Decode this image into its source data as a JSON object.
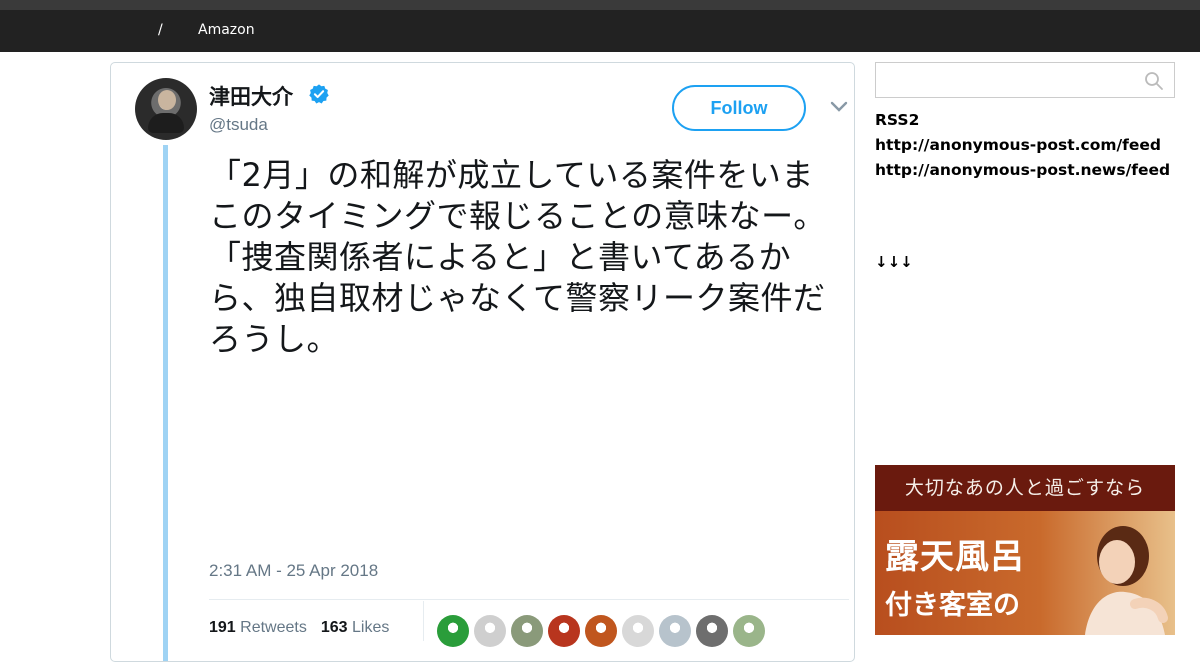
{
  "nav": {
    "separator": "/",
    "link": "Amazon"
  },
  "tweet": {
    "display_name": "津田大介",
    "handle": "@tsuda",
    "follow_label": "Follow",
    "text": "「2月」の和解が成立している案件をいまこのタイミングで報じることの意味なー。「捜査関係者によると」と書いてあるから、独自取材じゃなくて警察リーク案件だろうし。",
    "timestamp": "2:31 AM - 25 Apr 2018",
    "retweets_count": "191",
    "retweets_label": "Retweets",
    "likes_count": "163",
    "likes_label": "Likes",
    "accent_color": "#1da1f2",
    "liker_colors": [
      "#2a9d3a",
      "#cfcfcf",
      "#8a9a7a",
      "#b8351e",
      "#c0561e",
      "#d8d8d8",
      "#b7c3cc",
      "#6e6e6e",
      "#9ab58a"
    ]
  },
  "sidebar": {
    "search_placeholder": "",
    "rss_label": "RSS2",
    "feed1": "http://anonymous-post.com/feed",
    "feed2": "http://anonymous-post.news/feed",
    "arrows": "↓↓↓"
  },
  "ad": {
    "top_text": "大切なあの人と過ごすなら",
    "line1": "露天風呂",
    "line2": "付き客室の"
  }
}
